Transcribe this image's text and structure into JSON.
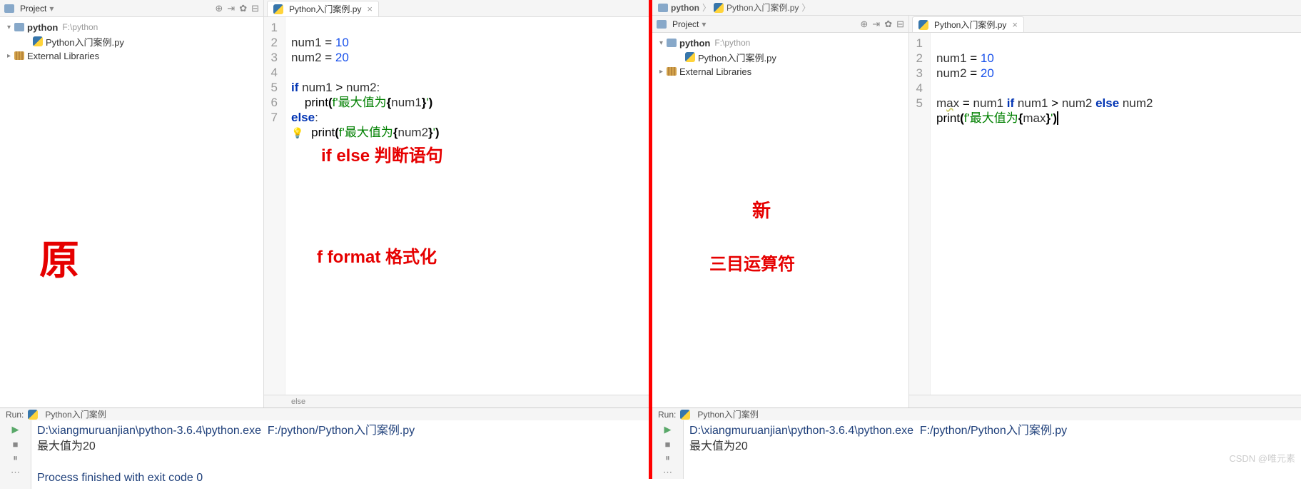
{
  "left": {
    "projectLabel": "Project",
    "tree": {
      "root": "python",
      "rootPath": "F:\\python",
      "file": "Python入门案例.py",
      "libs": "External Libraries"
    },
    "tab": "Python入门案例.py",
    "gutter": [
      "1",
      "2",
      "3",
      "4",
      "5",
      "6",
      "7"
    ],
    "footer": "else",
    "run": {
      "label": "Run:",
      "script": "Python入门案例",
      "cmd": "D:\\xiangmuruanjian\\python-3.6.4\\python.exe  F:/python/Python入门案例.py",
      "out": "最大值为20",
      "exit": "Process finished with exit code 0"
    },
    "annotations": {
      "big": "原",
      "ifelse": "if  else  判断语句",
      "fformat": "f  format 格式化"
    }
  },
  "right": {
    "breadcrumb": {
      "root": "python",
      "file": "Python入门案例.py"
    },
    "projectLabel": "Project",
    "tree": {
      "root": "python",
      "rootPath": "F:\\python",
      "file": "Python入门案例.py",
      "libs": "External Libraries"
    },
    "tab": "Python入门案例.py",
    "gutter": [
      "1",
      "2",
      "3",
      "4",
      "5"
    ],
    "run": {
      "label": "Run:",
      "script": "Python入门案例",
      "cmd": "D:\\xiangmuruanjian\\python-3.6.4\\python.exe  F:/python/Python入门案例.py",
      "out": "最大值为20"
    },
    "annotations": {
      "xin": "新",
      "ternary": "三目运算符"
    }
  },
  "watermark": "CSDN @唯元素"
}
